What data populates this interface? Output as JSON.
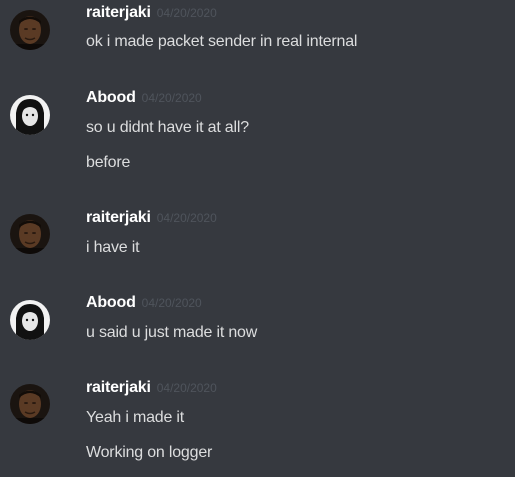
{
  "messages": [
    {
      "author": "raiterjaki",
      "timestamp": "04/20/2020",
      "avatar_icon": "user-avatar-dark-icon",
      "lines": [
        "ok i made packet sender in real internal"
      ]
    },
    {
      "author": "Abood",
      "timestamp": "04/20/2020",
      "avatar_icon": "user-avatar-bw-icon",
      "lines": [
        "so u didnt have it at all?",
        "before"
      ]
    },
    {
      "author": "raiterjaki",
      "timestamp": "04/20/2020",
      "avatar_icon": "user-avatar-dark-icon",
      "lines": [
        "i have it"
      ]
    },
    {
      "author": "Abood",
      "timestamp": "04/20/2020",
      "avatar_icon": "user-avatar-bw-icon",
      "lines": [
        "u said u just made it now"
      ]
    },
    {
      "author": "raiterjaki",
      "timestamp": "04/20/2020",
      "avatar_icon": "user-avatar-dark-icon",
      "lines": [
        "Yeah i made it",
        "Working on logger"
      ]
    }
  ],
  "colors": {
    "background": "#36393f",
    "username": "#ffffff",
    "timestamp": "#4f545c",
    "message_text": "#dcddde"
  }
}
